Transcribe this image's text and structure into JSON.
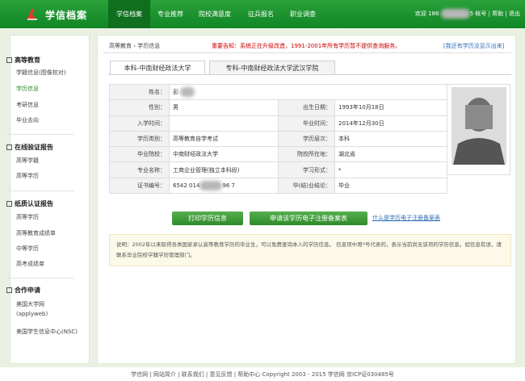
{
  "header": {
    "site_title": "学信档案",
    "nav": [
      "学信档案",
      "专业推荐",
      "院校满意度",
      "征兵报名",
      "职业调查"
    ],
    "welcome_prefix": "欢迎 186",
    "welcome_suffix": "5 帐号 | 帮助 | 退出"
  },
  "sidebar": {
    "sections": [
      {
        "title": "高等教育",
        "items": [
          "学籍信息(图像校对)",
          "学历信息",
          "考研信息",
          "毕业去向"
        ]
      },
      {
        "title": "在线验证报告",
        "items": [
          "高等学籍",
          "高等学历"
        ]
      },
      {
        "title": "纸质认证报告",
        "items": [
          "高等学历",
          "高等教育成绩单",
          "中等学历",
          "高考成绩单"
        ]
      },
      {
        "title": "合作申请",
        "items": [
          "美国大学网(applyweb)",
          "美国学生信息中心(NSC)"
        ]
      }
    ]
  },
  "breadcrumb": "高等教育 › 学历信息",
  "notice": "重要告知：系统正在升级改造，1991-2001年所有学历暂不提供查询服务。",
  "hide_link": "[我还有学历没显示出来]",
  "tabs": [
    "本科-中南财经政法大学",
    "专科-中南财经政法大学武汉学院"
  ],
  "record": {
    "name_label": "姓名：",
    "name_value": "彭",
    "gender_label": "性别：",
    "gender_value": "男",
    "birth_label": "出生日期：",
    "birth_value": "1993年10月18日",
    "enroll_label": "入学时间：",
    "enroll_value": "",
    "grad_label": "毕业时间：",
    "grad_value": "2014年12月30日",
    "type_label": "学历类别：",
    "type_value": "高等教育自学考试",
    "level_label": "学历层次：",
    "level_value": "本科",
    "school_label": "毕业院校：",
    "school_value": "中南财经政法大学",
    "loc_label": "院校所在地：",
    "loc_value": "湖北省",
    "major_label": "专业名称：",
    "major_value": "工商企业管理(独立本科段)",
    "form_label": "学习形式：",
    "form_value": "*",
    "cert_label": "证书编号：",
    "cert_prefix": "6542 014",
    "cert_suffix": "96 7",
    "concl_label": "毕(结)业结论：",
    "concl_value": "毕业"
  },
  "buttons": {
    "print": "打印学历信息",
    "apply": "申请该学历电子注册备案表"
  },
  "what_link": "什么是学历电子注册备案表",
  "note": "说明：2002年以来取得各类国家承认高等教育学历的毕业生，可以免费查询本人的学历信息。  信息项中用*号代表的，表示当前尚无该项的学历信息。如信息有误，请联系毕业院校学籍学历管理部门。",
  "footer": "学信网   |   网站简介   |   联系我们   |   意见反馈   |   帮助中心   Copyright 2003 - 2015  学信网  京ICP证030485号",
  "colors": {
    "brand_green": "#1a8f2c",
    "notice_red": "#cc0000",
    "link_blue": "#2d6db5"
  }
}
